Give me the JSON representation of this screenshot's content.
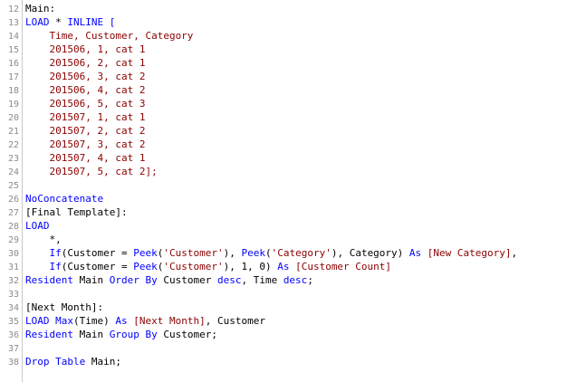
{
  "colors": {
    "plain": "#000000",
    "keyword": "#0000ff",
    "string": "#8b0000",
    "line_number": "#8c8c8c"
  },
  "lines": [
    {
      "n": "12",
      "tokens": [
        {
          "t": "Main:",
          "c": "plain"
        }
      ]
    },
    {
      "n": "13",
      "tokens": [
        {
          "t": "LOAD",
          "c": "kw"
        },
        {
          "t": " * ",
          "c": "plain"
        },
        {
          "t": "INLINE [",
          "c": "kw"
        }
      ]
    },
    {
      "n": "14",
      "tokens": [
        {
          "t": "    Time, Customer, Category",
          "c": "str"
        }
      ]
    },
    {
      "n": "15",
      "tokens": [
        {
          "t": "    201506, 1, cat 1",
          "c": "str"
        }
      ]
    },
    {
      "n": "16",
      "tokens": [
        {
          "t": "    201506, 2, cat 1",
          "c": "str"
        }
      ]
    },
    {
      "n": "17",
      "tokens": [
        {
          "t": "    201506, 3, cat 2",
          "c": "str"
        }
      ]
    },
    {
      "n": "18",
      "tokens": [
        {
          "t": "    201506, 4, cat 2",
          "c": "str"
        }
      ]
    },
    {
      "n": "19",
      "tokens": [
        {
          "t": "    201506, 5, cat 3",
          "c": "str"
        }
      ]
    },
    {
      "n": "20",
      "tokens": [
        {
          "t": "    201507, 1, cat 1",
          "c": "str"
        }
      ]
    },
    {
      "n": "21",
      "tokens": [
        {
          "t": "    201507, 2, cat 2",
          "c": "str"
        }
      ]
    },
    {
      "n": "22",
      "tokens": [
        {
          "t": "    201507, 3, cat 2",
          "c": "str"
        }
      ]
    },
    {
      "n": "23",
      "tokens": [
        {
          "t": "    201507, 4, cat 1",
          "c": "str"
        }
      ]
    },
    {
      "n": "24",
      "tokens": [
        {
          "t": "    201507, 5, cat 2];",
          "c": "str"
        }
      ]
    },
    {
      "n": "25",
      "tokens": []
    },
    {
      "n": "26",
      "tokens": [
        {
          "t": "NoConcatenate",
          "c": "kw"
        }
      ]
    },
    {
      "n": "27",
      "tokens": [
        {
          "t": "[Final Template]:",
          "c": "plain"
        }
      ]
    },
    {
      "n": "28",
      "tokens": [
        {
          "t": "LOAD",
          "c": "kw"
        }
      ]
    },
    {
      "n": "29",
      "tokens": [
        {
          "t": "    *,",
          "c": "plain"
        }
      ]
    },
    {
      "n": "30",
      "tokens": [
        {
          "t": "    ",
          "c": "plain"
        },
        {
          "t": "If",
          "c": "kw"
        },
        {
          "t": "(Customer = ",
          "c": "plain"
        },
        {
          "t": "Peek",
          "c": "kw"
        },
        {
          "t": "(",
          "c": "plain"
        },
        {
          "t": "'Customer'",
          "c": "str"
        },
        {
          "t": "), ",
          "c": "plain"
        },
        {
          "t": "Peek",
          "c": "kw"
        },
        {
          "t": "(",
          "c": "plain"
        },
        {
          "t": "'Category'",
          "c": "str"
        },
        {
          "t": "), Category) ",
          "c": "plain"
        },
        {
          "t": "As",
          "c": "kw"
        },
        {
          "t": " ",
          "c": "plain"
        },
        {
          "t": "[New Category]",
          "c": "str"
        },
        {
          "t": ",",
          "c": "plain"
        }
      ]
    },
    {
      "n": "31",
      "tokens": [
        {
          "t": "    ",
          "c": "plain"
        },
        {
          "t": "If",
          "c": "kw"
        },
        {
          "t": "(Customer = ",
          "c": "plain"
        },
        {
          "t": "Peek",
          "c": "kw"
        },
        {
          "t": "(",
          "c": "plain"
        },
        {
          "t": "'Customer'",
          "c": "str"
        },
        {
          "t": "), 1, 0) ",
          "c": "plain"
        },
        {
          "t": "As",
          "c": "kw"
        },
        {
          "t": " ",
          "c": "plain"
        },
        {
          "t": "[Customer Count]",
          "c": "str"
        }
      ]
    },
    {
      "n": "32",
      "tokens": [
        {
          "t": "Resident",
          "c": "kw"
        },
        {
          "t": " Main ",
          "c": "plain"
        },
        {
          "t": "Order By",
          "c": "kw"
        },
        {
          "t": " Customer ",
          "c": "plain"
        },
        {
          "t": "desc",
          "c": "kw"
        },
        {
          "t": ", Time ",
          "c": "plain"
        },
        {
          "t": "desc",
          "c": "kw"
        },
        {
          "t": ";",
          "c": "plain"
        }
      ]
    },
    {
      "n": "33",
      "tokens": []
    },
    {
      "n": "34",
      "tokens": [
        {
          "t": "[Next Month]:",
          "c": "plain"
        }
      ]
    },
    {
      "n": "35",
      "tokens": [
        {
          "t": "LOAD",
          "c": "kw"
        },
        {
          "t": " ",
          "c": "plain"
        },
        {
          "t": "Max",
          "c": "kw"
        },
        {
          "t": "(Time) ",
          "c": "plain"
        },
        {
          "t": "As",
          "c": "kw"
        },
        {
          "t": " ",
          "c": "plain"
        },
        {
          "t": "[Next Month]",
          "c": "str"
        },
        {
          "t": ", Customer",
          "c": "plain"
        }
      ]
    },
    {
      "n": "36",
      "tokens": [
        {
          "t": "Resident",
          "c": "kw"
        },
        {
          "t": " Main ",
          "c": "plain"
        },
        {
          "t": "Group By",
          "c": "kw"
        },
        {
          "t": " Customer;",
          "c": "plain"
        }
      ]
    },
    {
      "n": "37",
      "tokens": []
    },
    {
      "n": "38",
      "tokens": [
        {
          "t": "Drop Table",
          "c": "kw"
        },
        {
          "t": " Main;",
          "c": "plain"
        }
      ]
    }
  ]
}
